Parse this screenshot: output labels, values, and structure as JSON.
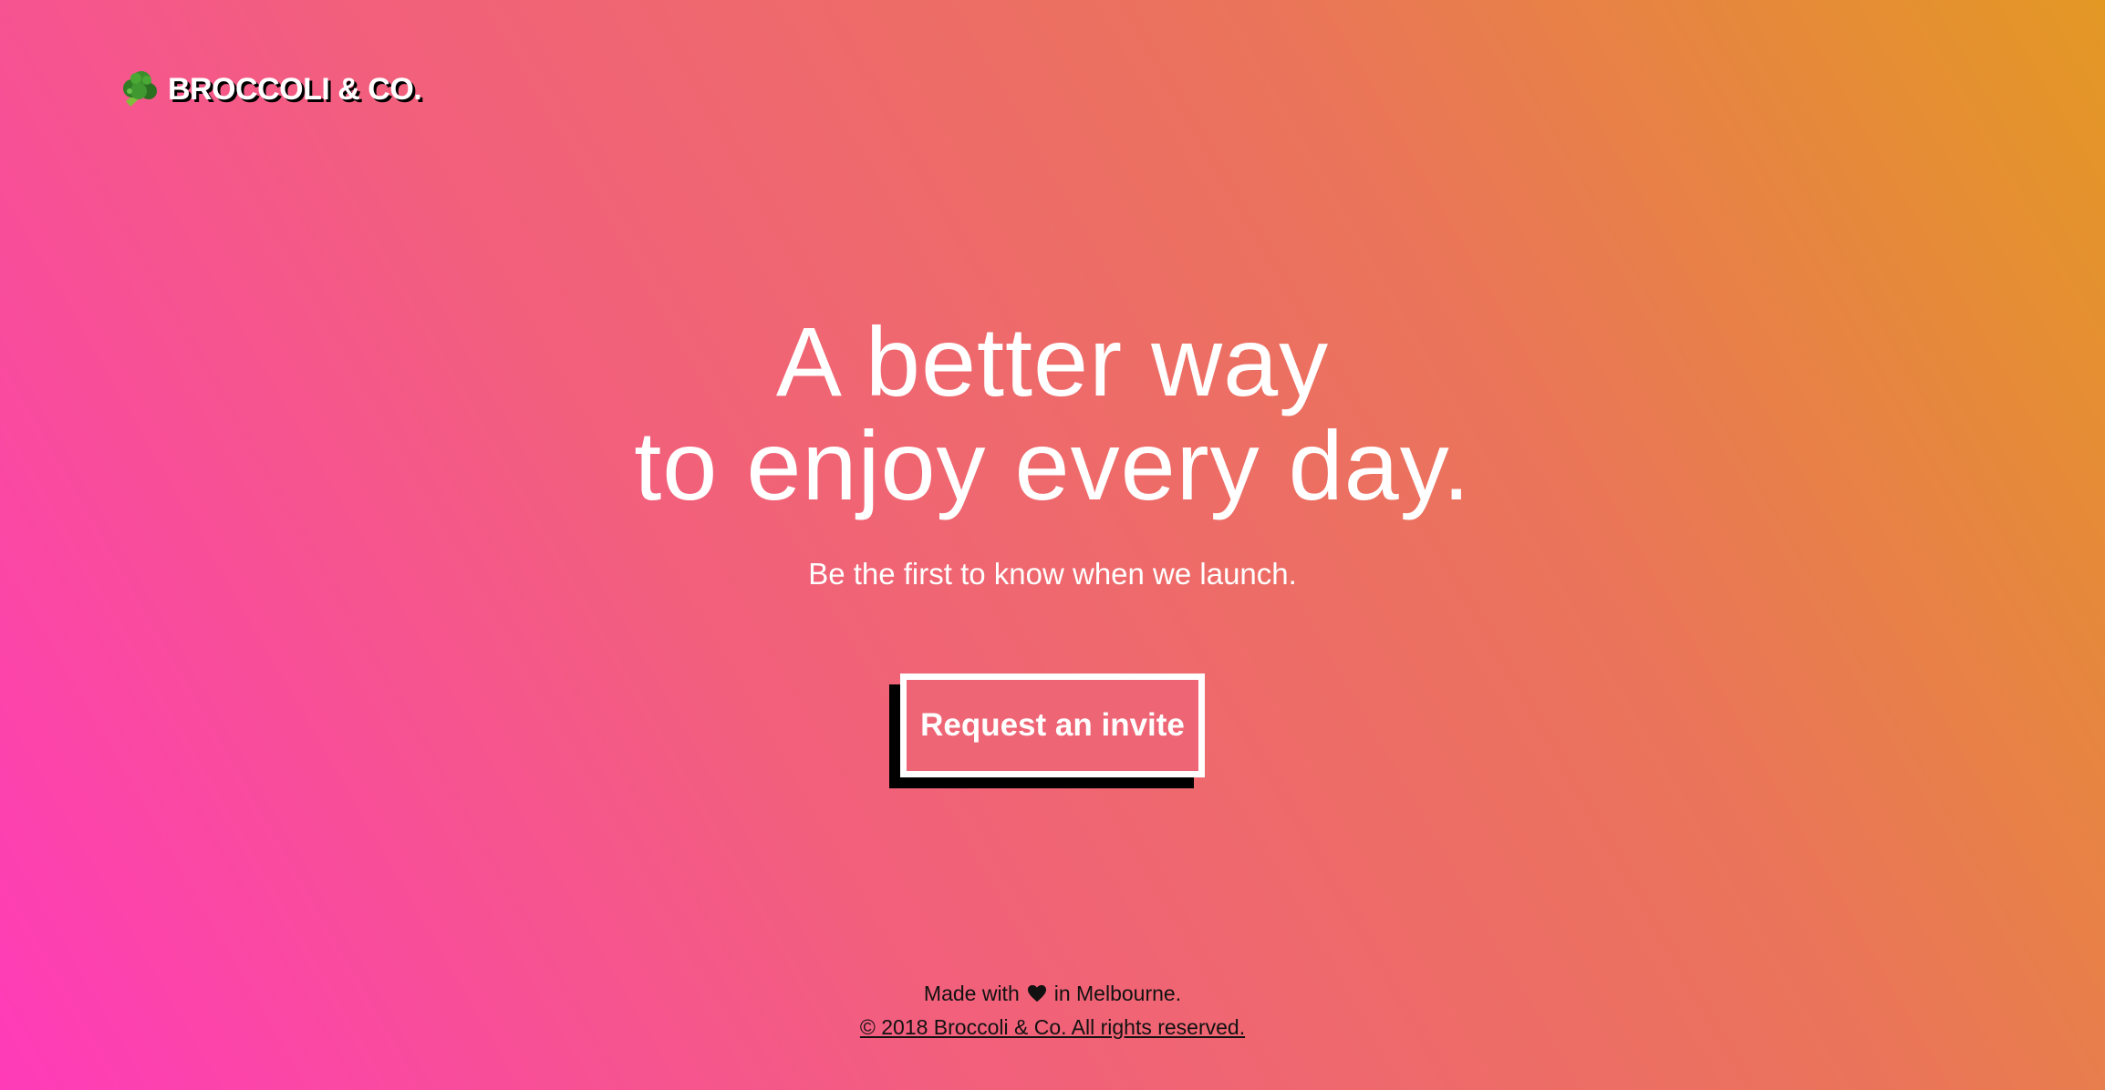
{
  "header": {
    "logo_icon": "broccoli-icon",
    "brand_name": "BROCCOLI & CO."
  },
  "hero": {
    "headline_line1": "A better way",
    "headline_line2": "to enjoy every day.",
    "subheadline": "Be the first to know when we launch.",
    "cta_label": "Request an invite"
  },
  "footer": {
    "made_with_prefix": "Made with",
    "heart_icon": "heart-icon",
    "made_with_suffix": "in Melbourne.",
    "copyright": "© 2018 Broccoli & Co. All rights reserved."
  },
  "colors": {
    "gradient_start": "#ff3bb9",
    "gradient_mid": "#f25f7d",
    "gradient_end": "#e39824",
    "text_primary": "#ffffff",
    "footer_text": "#111111",
    "button_shadow": "#000000"
  }
}
